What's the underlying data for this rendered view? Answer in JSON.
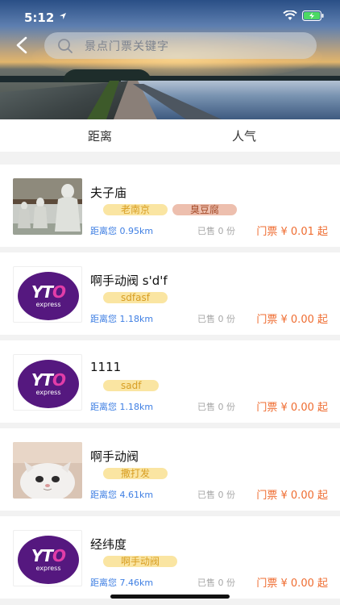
{
  "status_bar": {
    "time": "5:12"
  },
  "header": {
    "search_placeholder": "景点门票关键字"
  },
  "tabs": [
    {
      "label": "距离"
    },
    {
      "label": "人气"
    }
  ],
  "items": [
    {
      "name": "夫子庙",
      "tags": [
        "老南京",
        "臭豆腐"
      ],
      "distance": "距离您 0.95km",
      "sold": "已售 0 份",
      "price": "门票 ¥ 0.01 起",
      "image": "statues-photo"
    },
    {
      "name": "啊手动阀 s'd'f",
      "tags": [
        "sdfasf"
      ],
      "distance": "距离您 1.18km",
      "sold": "已售 0 份",
      "price": "门票 ¥ 0.00 起",
      "image": "yto-express-logo"
    },
    {
      "name": "1111",
      "tags": [
        "sadf"
      ],
      "distance": "距离您 1.18km",
      "sold": "已售 0 份",
      "price": "门票 ¥ 0.00 起",
      "image": "yto-express-logo"
    },
    {
      "name": "啊手动阀",
      "tags": [
        "撒打发"
      ],
      "distance": "距离您 4.61km",
      "sold": "已售 0 份",
      "price": "门票 ¥ 0.00 起",
      "image": "cat-photo"
    },
    {
      "name": "经纬度",
      "tags": [
        "啊手动阀"
      ],
      "distance": "距离您 7.46km",
      "sold": "已售 0 份",
      "price": "门票 ¥ 0.00 起",
      "image": "yto-express-logo"
    }
  ],
  "logo": {
    "brand_yt": "YT",
    "brand_o": "O",
    "brand_sub": "express"
  },
  "colors": {
    "distance": "#3f7fe3",
    "price": "#ef6c30",
    "tag_yellow": "#fae5a2",
    "tag_red": "#edbfae"
  }
}
